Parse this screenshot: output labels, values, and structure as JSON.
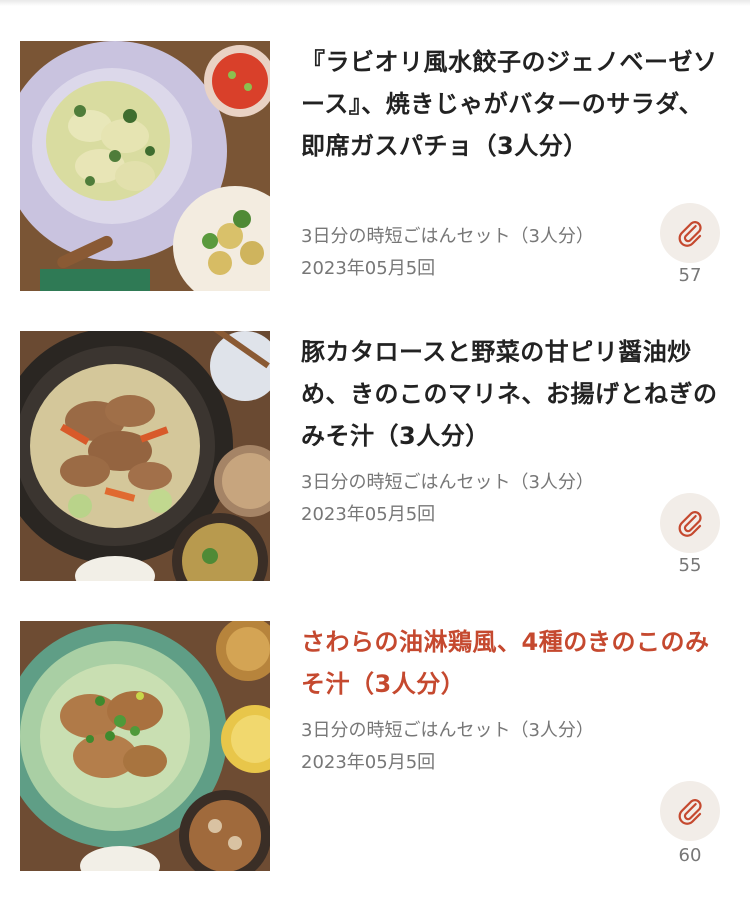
{
  "recipes": [
    {
      "title": "『ラビオリ風水餃子のジェノベーゼソース』、焼きじゃがバターのサラダ、即席ガスパチョ（3人分）",
      "category": "3日分の時短ごはんセット（3人分）",
      "date": "2023年05月5回",
      "clip_count": "57",
      "title_color": "#222222",
      "image_icon": "ravioli-dish-photo"
    },
    {
      "title": "豚カタロースと野菜の甘ピリ醤油炒め、きのこのマリネ、お揚げとねぎのみそ汁（3人分）",
      "category": "3日分の時短ごはんセット（3人分）",
      "date": "2023年05月5回",
      "clip_count": "55",
      "title_color": "#222222",
      "image_icon": "pork-stirfry-photo"
    },
    {
      "title": "さわらの油淋鶏風、4種のきのこのみそ汁（3人分）",
      "category": "3日分の時短ごはんセット（3人分）",
      "date": "2023年05月5回",
      "clip_count": "60",
      "title_color": "#c5492f",
      "image_icon": "sawara-fish-photo"
    }
  ],
  "clip_icon": "paperclip-icon",
  "accent_color": "#c5492f"
}
